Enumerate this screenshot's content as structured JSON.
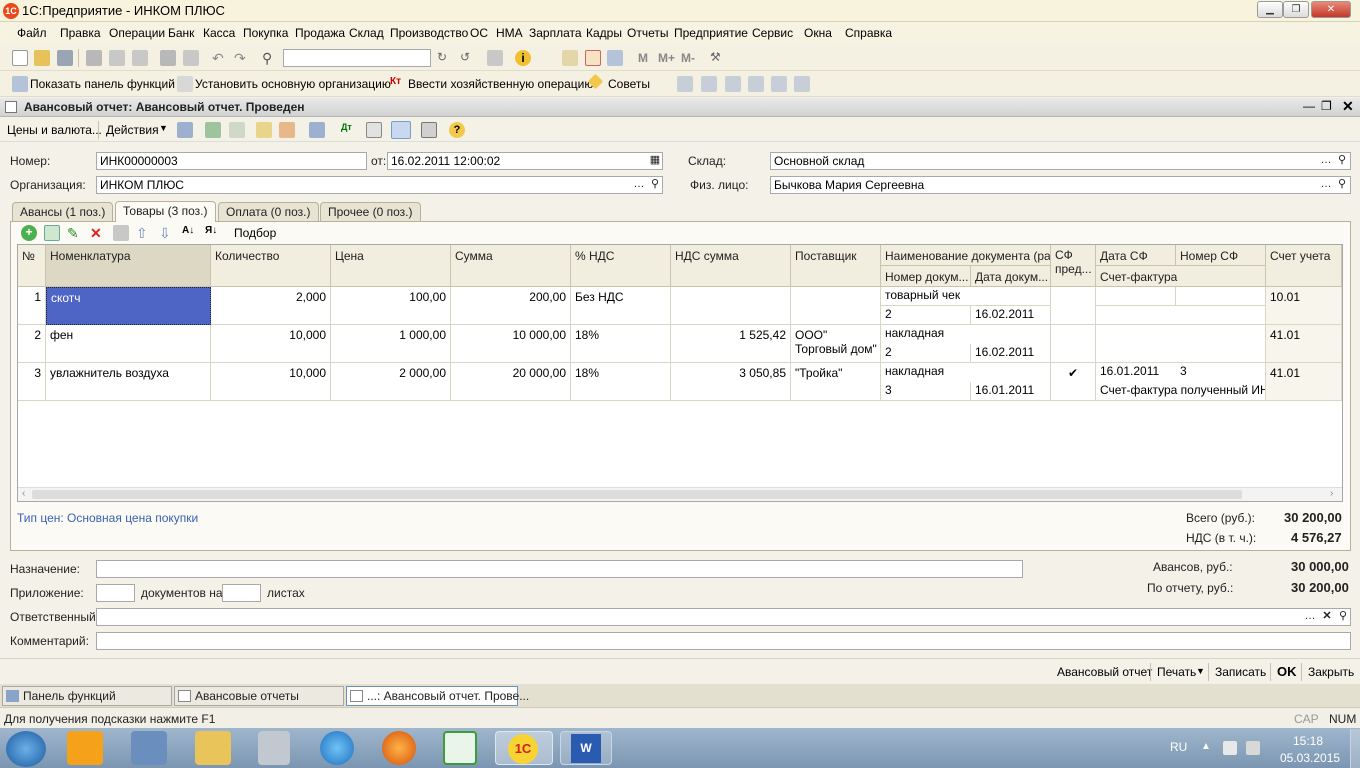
{
  "window": {
    "title": "1С:Предприятие - ИНКОМ ПЛЮС"
  },
  "menu": [
    "Файл",
    "Правка",
    "Операции",
    "Банк",
    "Касса",
    "Покупка",
    "Продажа",
    "Склад",
    "Производство",
    "ОС",
    "НМА",
    "Зарплата",
    "Кадры",
    "Отчеты",
    "Предприятие",
    "Сервис",
    "Окна",
    "Справка"
  ],
  "toolbar2": {
    "btn1": "Показать панель функций",
    "btn2": "Установить основную организацию",
    "btn3": "Ввести хозяйственную операцию",
    "btn4": "Советы",
    "m1": "M",
    "m2": "M+",
    "m3": "M-"
  },
  "doc": {
    "title": "Авансовый отчет: Авансовый отчет. Проведен",
    "toolbar": {
      "prices": "Цены и валюта...",
      "actions": "Действия"
    },
    "number_label": "Номер:",
    "number": "ИНК00000003",
    "from_label": "от:",
    "date": "16.02.2011 12:00:02",
    "org_label": "Организация:",
    "org": "ИНКОМ ПЛЮС",
    "store_label": "Склад:",
    "store": "Основной склад",
    "person_label": "Физ. лицо:",
    "person": "Бычкова Мария Сергеевна"
  },
  "tabs": [
    "Авансы (1 поз.)",
    "Товары (3 поз.)",
    "Оплата (0 поз.)",
    "Прочее (0 поз.)"
  ],
  "grid_toolbar": {
    "podbor": "Подбор"
  },
  "grid": {
    "headers": {
      "n": "№",
      "nom": "Номенклатура",
      "qty": "Количество",
      "price": "Цена",
      "sum": "Сумма",
      "vat_rate": "% НДС",
      "vat_sum": "НДС сумма",
      "supplier": "Поставщик",
      "docname": "Наименование документа (ра...",
      "docnum": "Номер докум...",
      "docdate": "Дата докум...",
      "sf": "СФ пред...",
      "sfdate": "Дата СФ",
      "sfnum": "Номер СФ",
      "sfdoc": "Счет-фактура",
      "account": "Счет учета"
    },
    "rows": [
      {
        "n": "1",
        "nom": "скотч",
        "qty": "2,000",
        "price": "100,00",
        "sum": "200,00",
        "vat_rate": "Без НДС",
        "vat_sum": "",
        "supplier1": "",
        "supplier2": "",
        "docname": "товарный чек",
        "docnum": "2",
        "docdate": "16.02.2011",
        "sf": "",
        "sfdate": "",
        "sfnum": "",
        "sfdoc": "",
        "account": "10.01"
      },
      {
        "n": "2",
        "nom": "фен",
        "qty": "10,000",
        "price": "1 000,00",
        "sum": "10 000,00",
        "vat_rate": "18%",
        "vat_sum": "1 525,42",
        "supplier1": "ООО\"",
        "supplier2": "Торговый дом\"",
        "docname": "накладная",
        "docnum": "2",
        "docdate": "16.02.2011",
        "sf": "",
        "sfdate": "",
        "sfnum": "",
        "sfdoc": "",
        "account": "41.01"
      },
      {
        "n": "3",
        "nom": "увлажнитель воздуха",
        "qty": "10,000",
        "price": "2 000,00",
        "sum": "20 000,00",
        "vat_rate": "18%",
        "vat_sum": "3 050,85",
        "supplier1": "\"Тройка\"",
        "supplier2": "",
        "docname": "накладная",
        "docnum": "3",
        "docdate": "16.01.2011",
        "sf": "✔",
        "sfdate": "16.01.2011",
        "sfnum": "3",
        "sfdoc": "Счет-фактура полученный ИН...",
        "account": "41.01"
      }
    ]
  },
  "price_type": "Тип цен: Основная цена покупки",
  "totals": {
    "total_label": "Всего (руб.):",
    "total": "30 200,00",
    "vat_label": "НДС (в т. ч.):",
    "vat": "4 576,27",
    "advances_label": "Авансов, руб.:",
    "advances": "30 000,00",
    "report_label": "По отчету, руб.:",
    "report": "30 200,00"
  },
  "footer_fields": {
    "purpose_label": "Назначение:",
    "attach_label": "Приложение:",
    "docs_on": "документов на",
    "sheets": "листах",
    "resp_label": "Ответственный:",
    "comment_label": "Комментарий:"
  },
  "bottom_buttons": {
    "report": "Авансовый отчет",
    "print": "Печать",
    "save": "Записать",
    "ok": "OK",
    "close": "Закрыть"
  },
  "taskbar": [
    "Панель функций",
    "Авансовые отчеты",
    "...: Авансовый отчет. Прове..."
  ],
  "status": {
    "hint": "Для получения подсказки нажмите F1",
    "cap": "CAP",
    "num": "NUM"
  },
  "tray": {
    "lang": "RU",
    "time": "15:18",
    "date": "05.03.2015"
  }
}
